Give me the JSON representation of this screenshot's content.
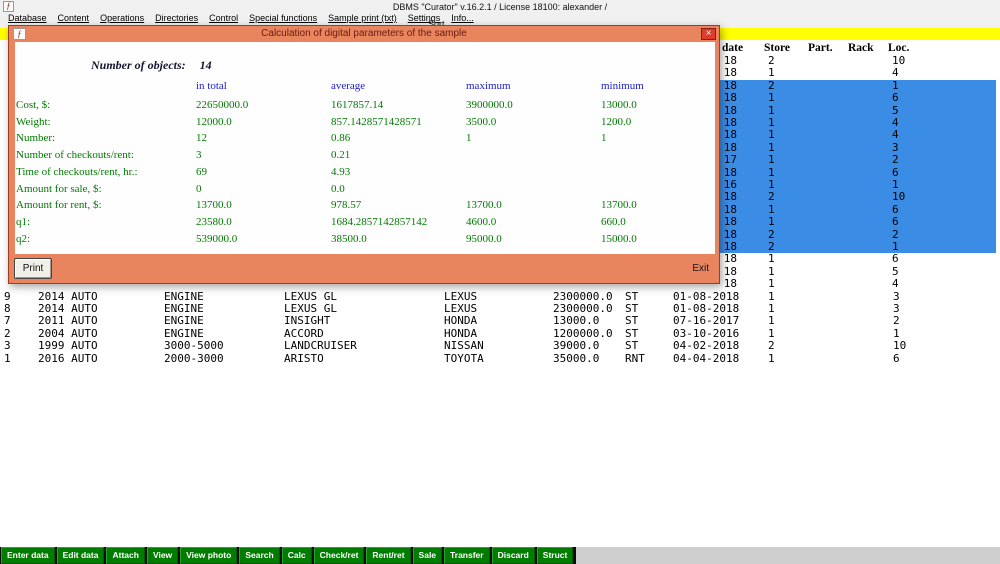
{
  "window": {
    "title": "DBMS \"Curator\" v.16.2.1   / License 18100: alexander /",
    "app_icon_glyph": "ƒ"
  },
  "menu": {
    "items": [
      "Database",
      "Content",
      "Operations",
      "Directories",
      "Control",
      "Special functions",
      "Sample print (txt)",
      "Settings",
      "Info..."
    ],
    "row2_items": [
      "Sort"
    ]
  },
  "table": {
    "visible_headers": [
      "date",
      "Store",
      "Part.",
      "Rack",
      "Loc."
    ],
    "partial_rows": [
      {
        "date": "18",
        "store": "2",
        "loc": "10",
        "hl": false
      },
      {
        "date": "18",
        "store": "1",
        "loc": "4",
        "hl": false
      },
      {
        "date": "18",
        "store": "2",
        "loc": "1",
        "hl": true
      },
      {
        "date": "18",
        "store": "1",
        "loc": "6",
        "hl": true
      },
      {
        "date": "18",
        "store": "1",
        "loc": "5",
        "hl": true
      },
      {
        "date": "18",
        "store": "1",
        "loc": "4",
        "hl": true
      },
      {
        "date": "18",
        "store": "1",
        "loc": "4",
        "hl": true
      },
      {
        "date": "18",
        "store": "1",
        "loc": "3",
        "hl": true
      },
      {
        "date": "17",
        "store": "1",
        "loc": "2",
        "hl": true
      },
      {
        "date": "18",
        "store": "1",
        "loc": "6",
        "hl": true
      },
      {
        "date": "16",
        "store": "1",
        "loc": "1",
        "hl": true
      },
      {
        "date": "18",
        "store": "2",
        "loc": "10",
        "hl": true
      },
      {
        "date": "18",
        "store": "1",
        "loc": "6",
        "hl": true
      },
      {
        "date": "18",
        "store": "1",
        "loc": "6",
        "hl": true
      },
      {
        "date": "18",
        "store": "2",
        "loc": "2",
        "hl": true
      },
      {
        "date": "18",
        "store": "2",
        "loc": "1",
        "hl": true
      },
      {
        "date": "18",
        "store": "1",
        "loc": "6",
        "hl": false
      },
      {
        "date": "18",
        "store": "1",
        "loc": "5",
        "hl": false
      },
      {
        "date": "18",
        "store": "1",
        "loc": "4",
        "hl": false
      }
    ],
    "rows": [
      {
        "id": "9",
        "year_type": "2014 AUTO",
        "category": "ENGINE",
        "model": "LEXUS GL",
        "brand": "LEXUS",
        "price": "2300000.0",
        "status": "ST",
        "date": "01-08-2018",
        "store": "1",
        "loc": "3"
      },
      {
        "id": "8",
        "year_type": "2014 AUTO",
        "category": "ENGINE",
        "model": "LEXUS GL",
        "brand": "LEXUS",
        "price": "2300000.0",
        "status": "ST",
        "date": "01-08-2018",
        "store": "1",
        "loc": "3"
      },
      {
        "id": "7",
        "year_type": "2011 AUTO",
        "category": "ENGINE",
        "model": "INSIGHT",
        "brand": "HONDA",
        "price": "13000.0",
        "status": "ST",
        "date": "07-16-2017",
        "store": "1",
        "loc": "2"
      },
      {
        "id": "2",
        "year_type": "2004 AUTO",
        "category": "ENGINE",
        "model": "ACCORD",
        "brand": "HONDA",
        "price": "1200000.0",
        "status": "ST",
        "date": "03-10-2016",
        "store": "1",
        "loc": "1"
      },
      {
        "id": "3",
        "year_type": "1999 AUTO",
        "category": "3000-5000",
        "model": "LANDCRUISER",
        "brand": "NISSAN",
        "price": "39000.0",
        "status": "ST",
        "date": "04-02-2018",
        "store": "2",
        "loc": "10"
      },
      {
        "id": "1",
        "year_type": "2016 AUTO",
        "category": "2000-3000",
        "model": "ARISTO",
        "brand": "TOYOTA",
        "price": "35000.0",
        "status": "RNT",
        "date": "04-04-2018",
        "store": "1",
        "loc": "6"
      }
    ]
  },
  "dialog": {
    "title": "Calculation of digital parameters of the sample",
    "close_icon": "×",
    "objects_label": "Number of objects:",
    "objects_value": "14",
    "columns": [
      "in total",
      "average",
      "maximum",
      "minimum"
    ],
    "rows": [
      {
        "label": "Cost, $:",
        "total": "22650000.0",
        "average": "1617857.14",
        "maximum": "3900000.0",
        "minimum": "13000.0"
      },
      {
        "label": "Weight:",
        "total": "12000.0",
        "average": "857.1428571428571",
        "maximum": "3500.0",
        "minimum": "1200.0"
      },
      {
        "label": "Number:",
        "total": "12",
        "average": "0.86",
        "maximum": "1",
        "minimum": "1"
      },
      {
        "label": "Number of checkouts/rent:",
        "total": "3",
        "average": "0.21",
        "maximum": "",
        "minimum": ""
      },
      {
        "label": "Time of checkouts/rent, hr.:",
        "total": "69",
        "average": "4.93",
        "maximum": "",
        "minimum": ""
      },
      {
        "label": "Amount for sale, $:",
        "total": "0",
        "average": "0.0",
        "maximum": "",
        "minimum": ""
      },
      {
        "label": "Amount for rent, $:",
        "total": "13700.0",
        "average": "978.57",
        "maximum": "13700.0",
        "minimum": "13700.0"
      },
      {
        "label": "q1:",
        "total": "23580.0",
        "average": "1684.2857142857142",
        "maximum": "4600.0",
        "minimum": "660.0"
      },
      {
        "label": "q2:",
        "total": "539000.0",
        "average": "38500.0",
        "maximum": "95000.0",
        "minimum": "15000.0"
      }
    ],
    "print_label": "Print",
    "exit_label": "Exit"
  },
  "toolbar": {
    "buttons": [
      "Enter data",
      "Edit data",
      "Attach",
      "View",
      "View photo",
      "Search",
      "Calc",
      "Check/ret",
      "Rent/ret",
      "Sale",
      "Transfer",
      "Discard",
      "Struct"
    ]
  },
  "colors": {
    "dialog_frame": "#e8855f",
    "row_highlight": "#3b8ce4",
    "stat_green": "#007a00",
    "stat_header_blue": "#2121c8",
    "strip_yellow": "#ffff00",
    "toolbar_button_green": "#007d00",
    "close_button_red": "#e03a2a"
  }
}
